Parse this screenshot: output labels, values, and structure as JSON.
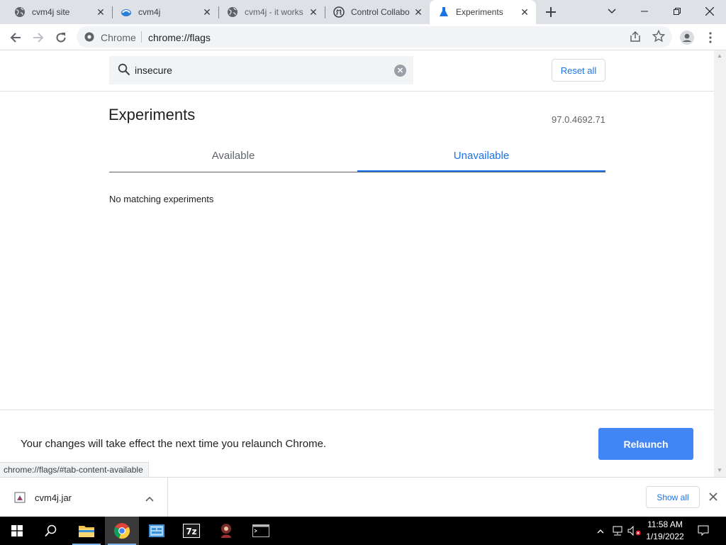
{
  "tabs": [
    {
      "label": "cvm4j site",
      "icon": "globe-icon"
    },
    {
      "label": "cvm4j",
      "icon": "cvm4j-logo-icon"
    },
    {
      "label": "cvm4j - it works",
      "icon": "globe-icon"
    },
    {
      "label": "Control Collabo",
      "icon": "github-icon"
    },
    {
      "label": "Experiments",
      "icon": "flask-icon",
      "active": true
    }
  ],
  "omnibox": {
    "scheme_label": "Chrome",
    "url": "chrome://flags"
  },
  "search": {
    "value": "insecure",
    "reset_label": "Reset all"
  },
  "experiments": {
    "title": "Experiments",
    "version": "97.0.4692.71"
  },
  "page_tabs": {
    "available": "Available",
    "unavailable": "Unavailable",
    "selected": "Unavailable"
  },
  "results": {
    "empty_message": "No matching experiments"
  },
  "relaunch": {
    "message": "Your changes will take effect the next time you relaunch Chrome.",
    "button": "Relaunch"
  },
  "status_bar": {
    "url": "chrome://flags/#tab-content-available"
  },
  "downloads": {
    "file_name": "cvm4j.jar",
    "show_all": "Show all"
  },
  "taskbar": {
    "apps": [
      "start-icon",
      "search-icon",
      "file-explorer-icon",
      "chrome-icon",
      "control-panel-icon",
      "7zip-icon",
      "cvm4j-app-icon",
      "terminal-icon"
    ],
    "time": "11:58 AM",
    "date": "1/19/2022"
  },
  "colors": {
    "accent": "#1a73e8",
    "relaunch_button": "#4285f4",
    "tabstrip": "#dee1e6"
  }
}
